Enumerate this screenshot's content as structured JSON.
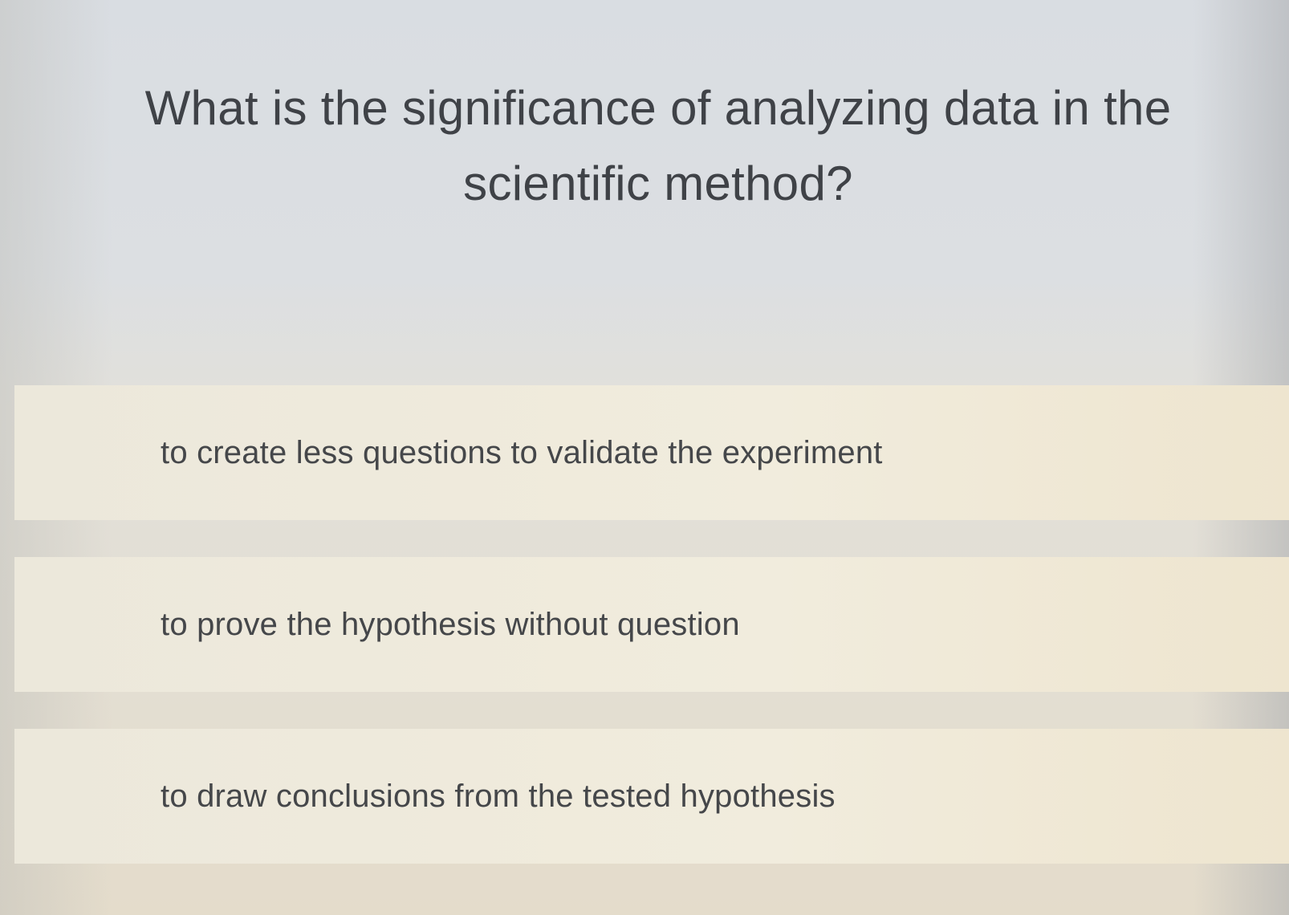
{
  "question": {
    "line1": "What is the significance of analyzing data in the",
    "line2": "scientific method?"
  },
  "choices": [
    {
      "label": "to create less questions to validate the experiment"
    },
    {
      "label": "to prove the hypothesis without question"
    },
    {
      "label": "to draw conclusions from the tested hypothesis"
    }
  ]
}
